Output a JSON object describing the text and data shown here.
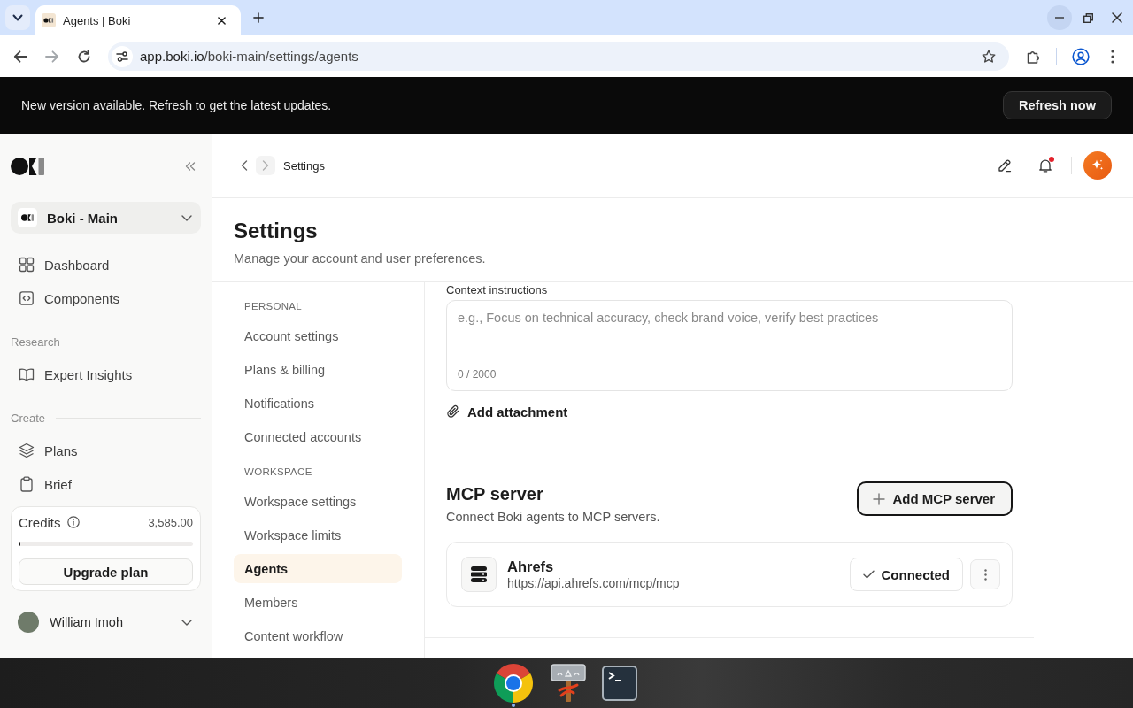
{
  "browser": {
    "tabs": [
      {
        "title": "Agents | Boki",
        "selected": true
      }
    ],
    "url": {
      "host": "app.boki.io",
      "path": "/boki-main/settings/agents"
    }
  },
  "banner": {
    "message": "New version available. Refresh to get the latest updates.",
    "button": "Refresh now"
  },
  "sidebar": {
    "workspace": "Boki - Main",
    "sections": [
      {
        "items": [
          {
            "label": "Dashboard",
            "selected": false
          },
          {
            "label": "Components",
            "selected": false
          }
        ]
      },
      {
        "title": "Research",
        "items": [
          {
            "label": "Expert Insights",
            "selected": false
          }
        ]
      },
      {
        "title": "Create",
        "items": [
          {
            "label": "Plans",
            "selected": false
          },
          {
            "label": "Brief",
            "selected": false
          }
        ]
      }
    ],
    "credits": {
      "label": "Credits",
      "value": "3,585.00",
      "level": 0.01,
      "button": "Upgrade plan"
    },
    "user": {
      "name": "William Imoh"
    }
  },
  "topbar": {
    "breadcrumb": "Settings",
    "notifications": {
      "unread": true
    }
  },
  "page": {
    "title": "Settings",
    "subtitle": "Manage your account and user preferences."
  },
  "settings_nav": {
    "sections": [
      {
        "title": "PERSONAL",
        "items": [
          {
            "label": "Account settings",
            "selected": false
          },
          {
            "label": "Plans & billing",
            "selected": false
          },
          {
            "label": "Notifications",
            "selected": false
          },
          {
            "label": "Connected accounts",
            "selected": false
          }
        ]
      },
      {
        "title": "WORKSPACE",
        "items": [
          {
            "label": "Workspace settings",
            "selected": false
          },
          {
            "label": "Workspace limits",
            "selected": false
          },
          {
            "label": "Agents",
            "selected": true
          },
          {
            "label": "Members",
            "selected": false
          },
          {
            "label": "Content workflow",
            "selected": false
          }
        ]
      }
    ]
  },
  "agent_context": {
    "label": "Context instructions",
    "placeholder": "e.g., Focus on technical accuracy, check brand voice, verify best practices",
    "counter": "0 / 2000",
    "attachment_button": "Add attachment"
  },
  "mcp": {
    "title": "MCP server",
    "description": "Connect Boki agents to MCP servers.",
    "add_button": "Add MCP server",
    "servers": [
      {
        "name": "Ahrefs",
        "url": "https://api.ahrefs.com/mcp/mcp",
        "status": "Connected"
      }
    ]
  },
  "taskbar": {
    "apps": [
      {
        "running": true
      },
      {
        "running": false
      },
      {
        "running": false
      }
    ]
  }
}
